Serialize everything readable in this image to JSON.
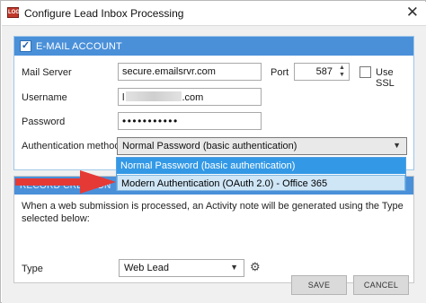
{
  "window": {
    "title": "Configure Lead Inbox Processing",
    "icon_text": "LOG",
    "close_glyph": "✕"
  },
  "email_account": {
    "header": "E-MAIL ACCOUNT",
    "enabled": true,
    "check_glyph": "✓",
    "mail_server_label": "Mail Server",
    "mail_server_value": "secure.emailsrvr.com",
    "port_label": "Port",
    "port_value": "587",
    "use_ssl_label": "Use SSL",
    "username_label": "Username",
    "username_prefix": "l",
    "username_suffix": ".com",
    "password_label": "Password",
    "password_mask": "•••••••••••",
    "auth_label": "Authentication method",
    "auth_value": "Normal Password (basic authentication)",
    "auth_options": [
      "Normal Password (basic authentication)",
      "Modern Authentication (OAuth 2.0) - Office 365"
    ]
  },
  "record_creation": {
    "header": "RECORD CREATION",
    "description": "When a web submission is processed, an Activity note will be generated using the Type selected below:",
    "type_label": "Type",
    "type_value": "Web Lead"
  },
  "buttons": {
    "save": "SAVE",
    "cancel": "CANCEL"
  },
  "colors": {
    "accent": "#4a90d9",
    "selected_option": "#3399e6",
    "hover_option": "#cfe6f7",
    "annotation_arrow": "#e53935"
  },
  "icons": {
    "dropdown_arrow": "▼",
    "spin_up": "▲",
    "spin_down": "▼",
    "gear": "⚙"
  }
}
